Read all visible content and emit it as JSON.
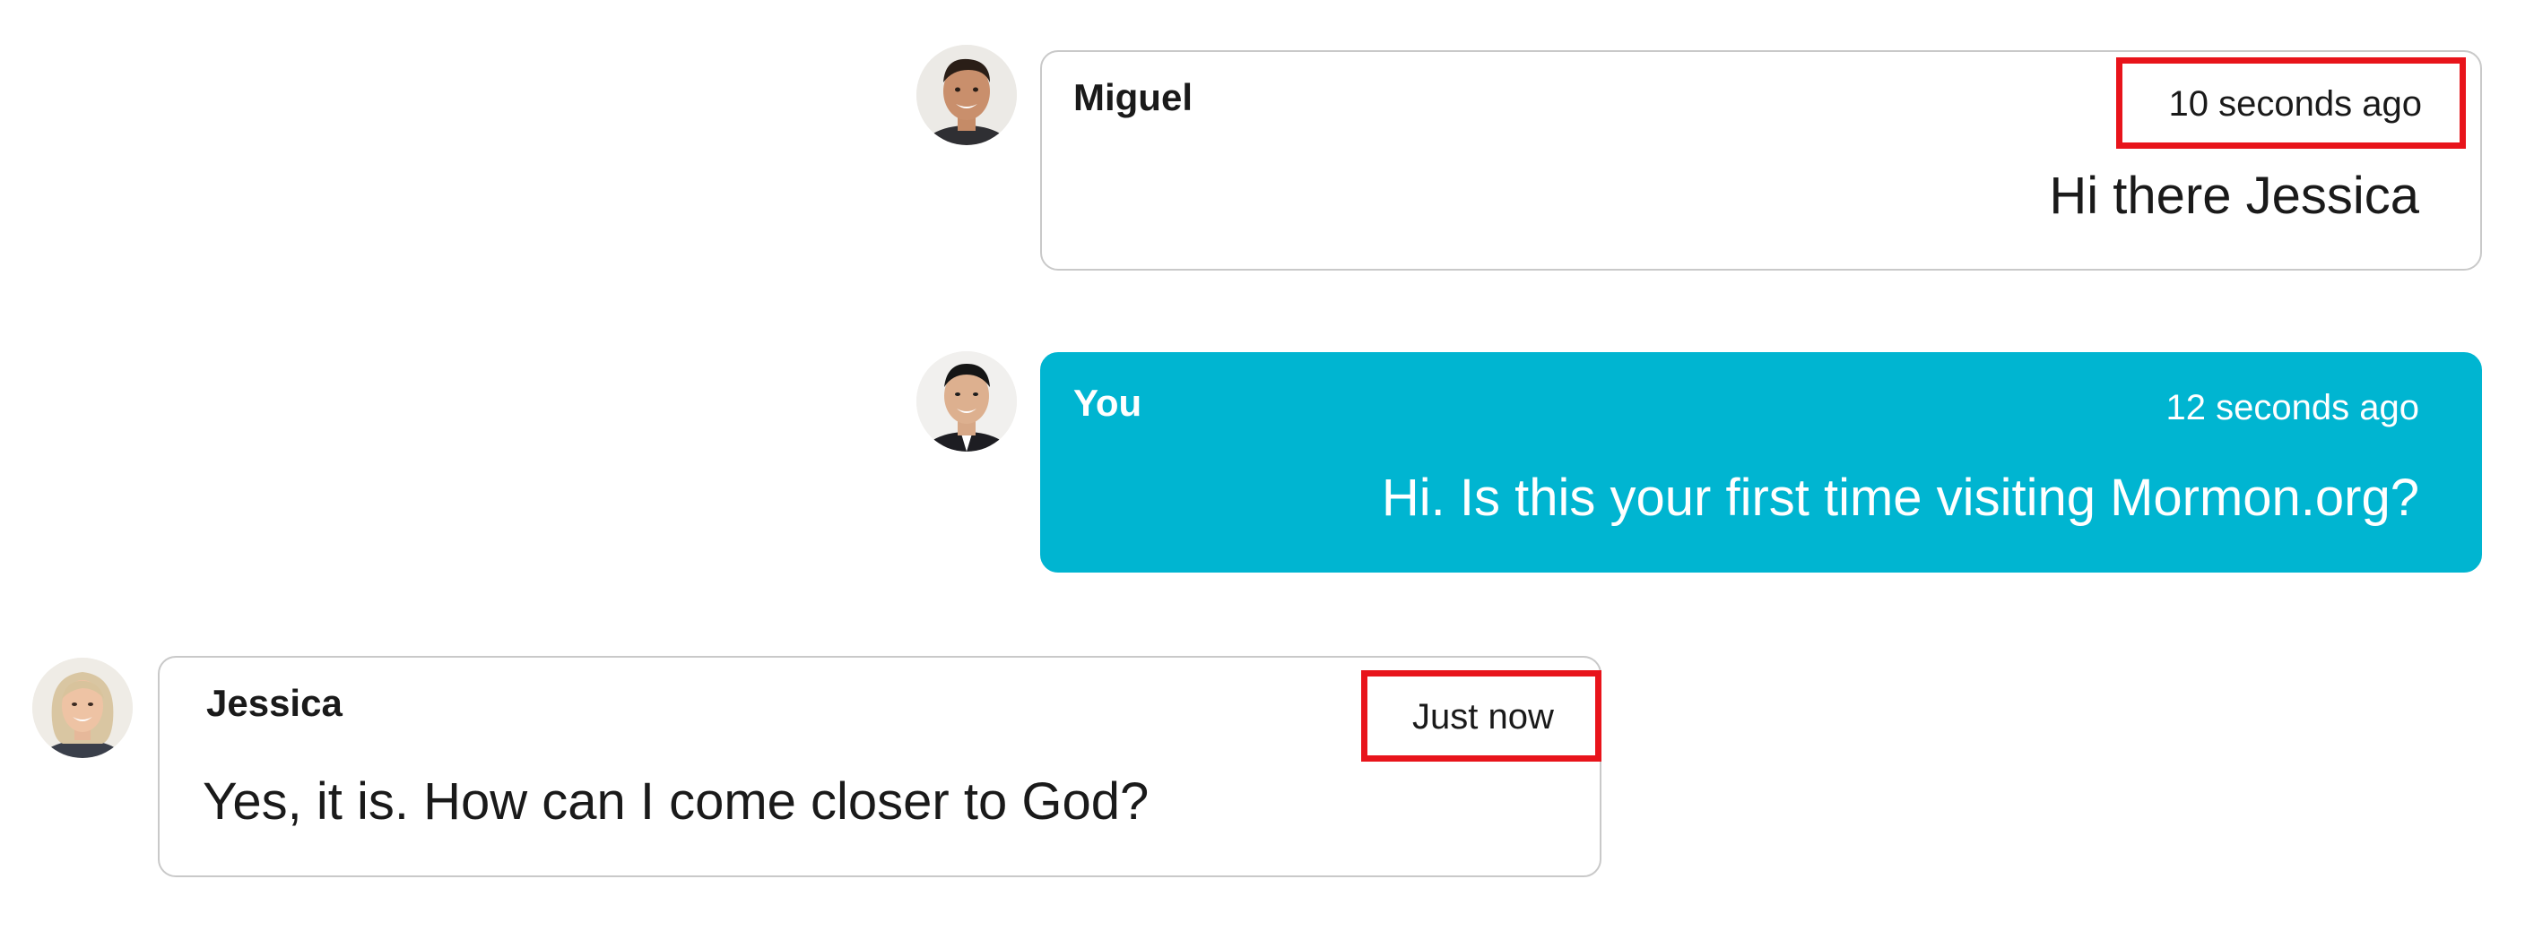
{
  "messages": [
    {
      "sender": "Miguel",
      "timestamp": "10 seconds ago",
      "text": "Hi there Jessica",
      "avatar_icon": "man-portrait-avatar",
      "timestamp_highlighted": true
    },
    {
      "sender": "You",
      "timestamp": "12 seconds ago",
      "text": "Hi. Is this your first time visiting Mormon.org?",
      "avatar_icon": "man-portrait-avatar",
      "timestamp_highlighted": false
    },
    {
      "sender": "Jessica",
      "timestamp": "Just now",
      "text": "Yes, it is. How can I come closer to God?",
      "avatar_icon": "woman-portrait-avatar",
      "timestamp_highlighted": true
    }
  ],
  "colors": {
    "self_bubble": "#00b5d1",
    "highlight_box": "#e8141b",
    "bubble_border": "#c9c9c9"
  }
}
